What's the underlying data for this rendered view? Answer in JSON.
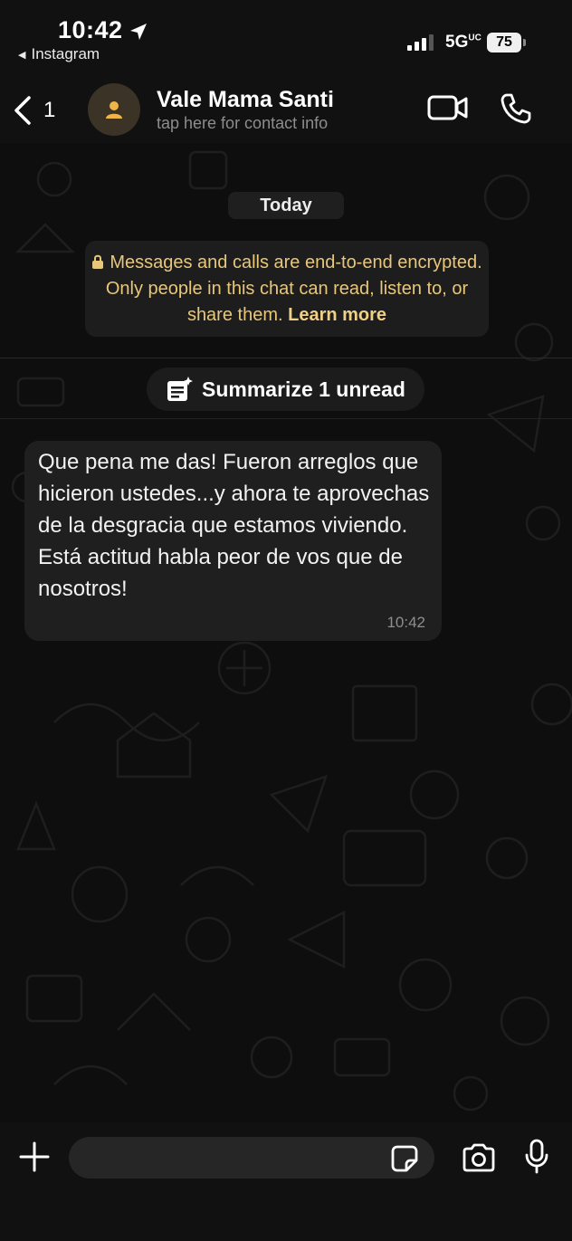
{
  "status": {
    "time": "10:42",
    "back_app": "Instagram",
    "network": "5G",
    "network_suffix": "UC",
    "battery": "75"
  },
  "header": {
    "back_count": "1",
    "contact_name": "Vale Mama Santi",
    "contact_subtitle": "tap here for contact info"
  },
  "chat": {
    "date_label": "Today",
    "encryption_text": "Messages and calls are end-to-end encrypted. Only people in this chat can read, listen to, or share them.",
    "encryption_link": "Learn more",
    "summarize_label": "Summarize 1 unread",
    "messages": [
      {
        "text": "Que pena me das! Fueron arreglos que hicieron ustedes...y ahora te aprovechas de la desgracia que estamos viviendo. Está actitud habla peor de vos que de nosotros!",
        "time": "10:42"
      }
    ]
  },
  "composer": {
    "value": ""
  },
  "colors": {
    "accent_gold": "#e9c77a",
    "bubble_bg": "#1f1f1f",
    "background": "#0e0e0e"
  }
}
